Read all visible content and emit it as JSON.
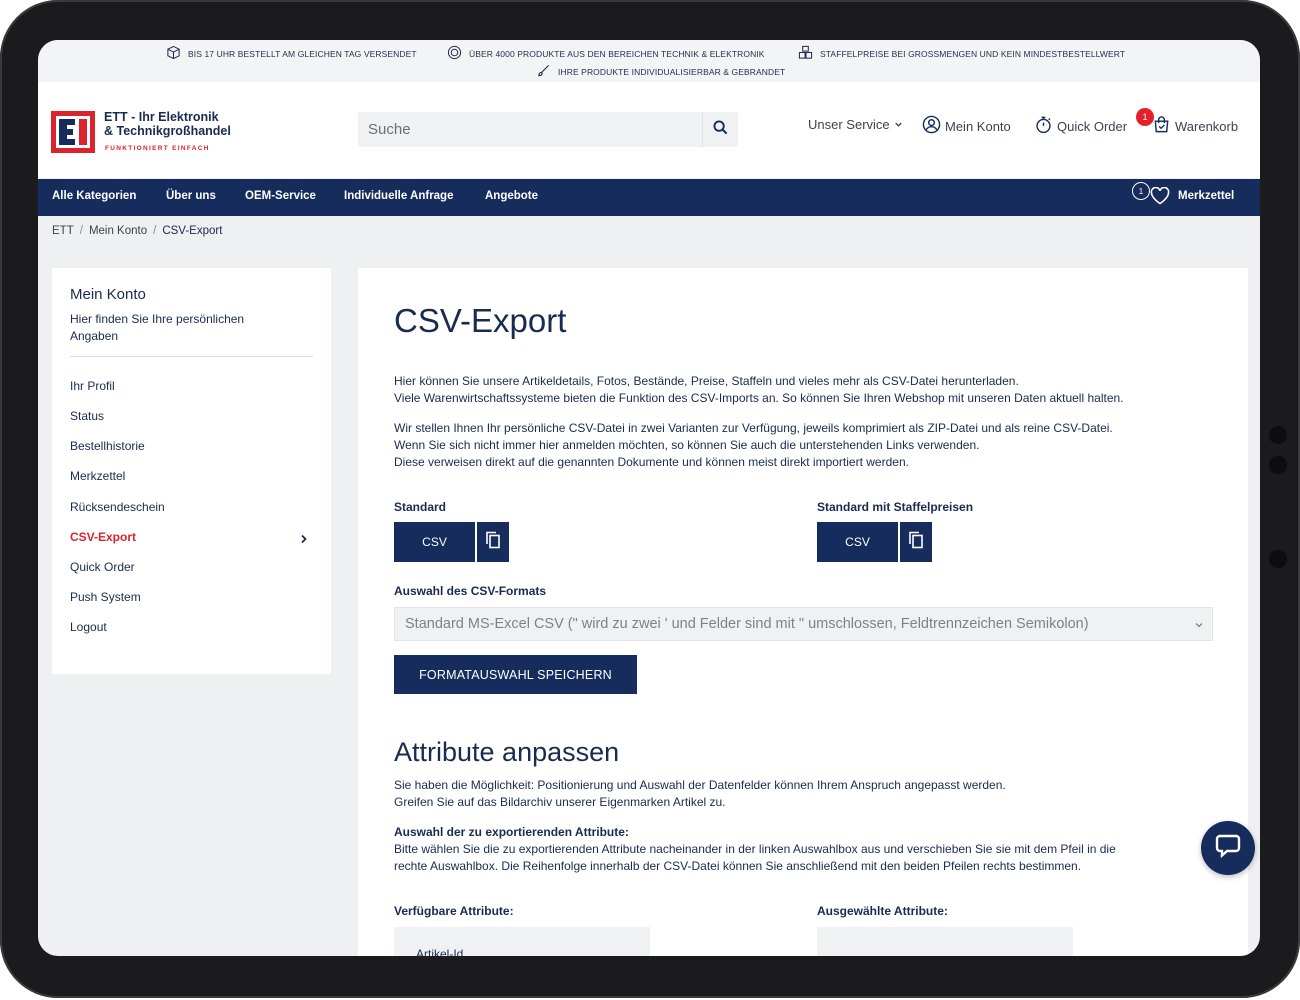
{
  "infobar": {
    "item1": "BIS 17 UHR BESTELLT AM GLEICHEN TAG VERSENDET",
    "item2": "ÜBER 4000 PRODUKTE AUS DEN BEREICHEN TECHNIK & ELEKTRONIK",
    "item3": "STAFFELPREISE BEI GROSSMENGEN UND KEIN MINDESTBESTELLWERT",
    "item4": "IHRE PRODUKTE INDIVIDUALISIERBAR & GEBRANDET"
  },
  "header": {
    "logo_line1": "ETT - Ihr Elektronik",
    "logo_line2": "& Technikgroßhandel",
    "logo_tagline": "FUNKTIONIERT EINFACH",
    "search_placeholder": "Suche",
    "service": "Unser Service",
    "account": "Mein Konto",
    "quick_order": "Quick Order",
    "cart": "Warenkorb",
    "cart_count": "1"
  },
  "nav": {
    "items": [
      "Alle Kategorien",
      "Über uns",
      "OEM-Service",
      "Individuelle Anfrage",
      "Angebote"
    ],
    "wishlist": "Merkzettel",
    "wishlist_count": "1"
  },
  "breadcrumb": [
    "ETT",
    "Mein Konto",
    "CSV-Export"
  ],
  "sidebar": {
    "title": "Mein Konto",
    "description": "Hier finden Sie Ihre persönlichen Angaben",
    "items": [
      "Ihr Profil",
      "Status",
      "Bestellhistorie",
      "Merkzettel",
      "Rücksendeschein",
      "CSV-Export",
      "Quick Order",
      "Push System",
      "Logout"
    ]
  },
  "main": {
    "title": "CSV-Export",
    "intro1": "Hier können Sie unsere Artikeldetails, Fotos, Bestände, Preise, Staffeln und vieles mehr als CSV-Datei herunterladen.",
    "intro2": "Viele Warenwirtschaftssysteme bieten die Funktion des CSV-Imports an. So können Sie Ihren Webshop mit unseren Daten aktuell halten.",
    "info1": "Wir stellen Ihnen Ihr persönliche CSV-Datei in zwei Varianten zur Verfügung, jeweils komprimiert als ZIP-Datei und als reine CSV-Datei.",
    "info2": "Wenn Sie sich nicht immer hier anmelden möchten, so können Sie auch die unterstehenden Links verwenden.",
    "info3": "Diese verweisen direkt auf die genannten Dokumente und können meist direkt importiert werden.",
    "standard_label": "Standard",
    "staffel_label": "Standard mit Staffelpreisen",
    "csv_button": "CSV",
    "format_label": "Auswahl des CSV-Formats",
    "format_value": "Standard MS-Excel CSV (\" wird zu zwei ' und Felder sind mit \" umschlossen, Feldtrennzeichen Semikolon)",
    "save_button": "FORMATAUSWAHL SPEICHERN",
    "attr_title": "Attribute anpassen",
    "attr_p1": "Sie haben die Möglichkeit: Positionierung und Auswahl der Datenfelder können Ihrem Anspruch angepasst werden.",
    "attr_p2": "Greifen Sie auf das Bildarchiv unserer Eigenmarken Artikel zu.",
    "attr_sub": "Auswahl der zu exportierenden Attribute:",
    "attr_p3": "Bitte wählen Sie die zu exportierenden Attribute nacheinander in der linken Auswahlbox aus und verschieben Sie sie mit dem Pfeil in die",
    "attr_p4": "rechte Auswahlbox. Die Reihenfolge innerhalb der CSV-Datei können Sie anschließend mit den beiden Pfeilen rechts bestimmen.",
    "available_label": "Verfügbare Attribute:",
    "selected_label": "Ausgewählte Attribute:",
    "available_first": "Artikel-Id"
  },
  "colors": {
    "navy": "#162c5c",
    "red": "#d9232d"
  }
}
